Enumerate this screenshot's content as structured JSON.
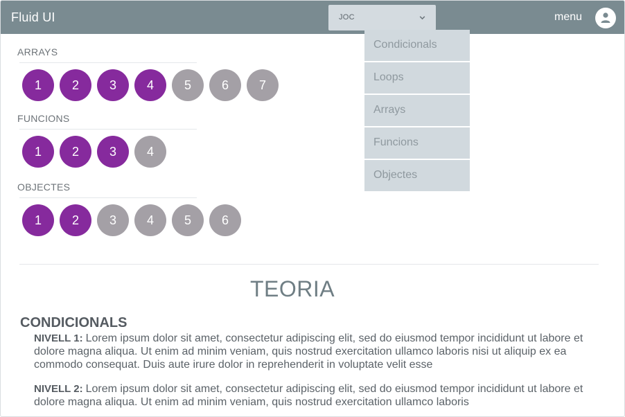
{
  "header": {
    "brand": "Fluid UI",
    "select_value": "JOC",
    "menu_label": "menu"
  },
  "dropdown": {
    "items": [
      "Condicionals",
      "Loops",
      "Arrays",
      "Funcions",
      "Objectes"
    ]
  },
  "groups": [
    {
      "title": "ARRAYS",
      "items": [
        {
          "label": "1",
          "status": "done"
        },
        {
          "label": "2",
          "status": "done"
        },
        {
          "label": "3",
          "status": "done"
        },
        {
          "label": "4",
          "status": "done"
        },
        {
          "label": "5",
          "status": "todo"
        },
        {
          "label": "6",
          "status": "todo"
        },
        {
          "label": "7",
          "status": "todo"
        }
      ]
    },
    {
      "title": "FUNCIONS",
      "items": [
        {
          "label": "1",
          "status": "done"
        },
        {
          "label": "2",
          "status": "done"
        },
        {
          "label": "3",
          "status": "done"
        },
        {
          "label": "4",
          "status": "todo"
        }
      ]
    },
    {
      "title": "OBJECTES",
      "items": [
        {
          "label": "1",
          "status": "done"
        },
        {
          "label": "2",
          "status": "done"
        },
        {
          "label": "3",
          "status": "todo"
        },
        {
          "label": "4",
          "status": "todo"
        },
        {
          "label": "5",
          "status": "todo"
        },
        {
          "label": "6",
          "status": "todo"
        }
      ]
    }
  ],
  "teoria": {
    "title": "TEORIA",
    "topic": "CONDICIONALS",
    "levels": [
      {
        "label": "NIVELL 1:",
        "text": "Lorem ipsum dolor sit amet, consectetur adipiscing elit, sed do eiusmod tempor incididunt ut labore et dolore magna aliqua. Ut enim ad minim veniam, quis nostrud exercitation ullamco laboris nisi ut aliquip ex ea commodo consequat. Duis aute irure dolor in reprehenderit in voluptate velit esse"
      },
      {
        "label": "NIVELL 2:",
        "text": "Lorem ipsum dolor sit amet, consectetur adipiscing elit, sed do eiusmod tempor incididunt ut labore et dolore magna aliqua. Ut enim ad minim veniam, quis nostrud exercitation ullamco laboris"
      }
    ]
  },
  "colors": {
    "header_bg": "#7a8b91",
    "done": "#862a9d",
    "todo": "#a4a0a6",
    "dropdown_bg": "#d1d9de"
  },
  "icons": {
    "select_chevron": "chevron-down-icon",
    "avatar": "user-icon"
  }
}
